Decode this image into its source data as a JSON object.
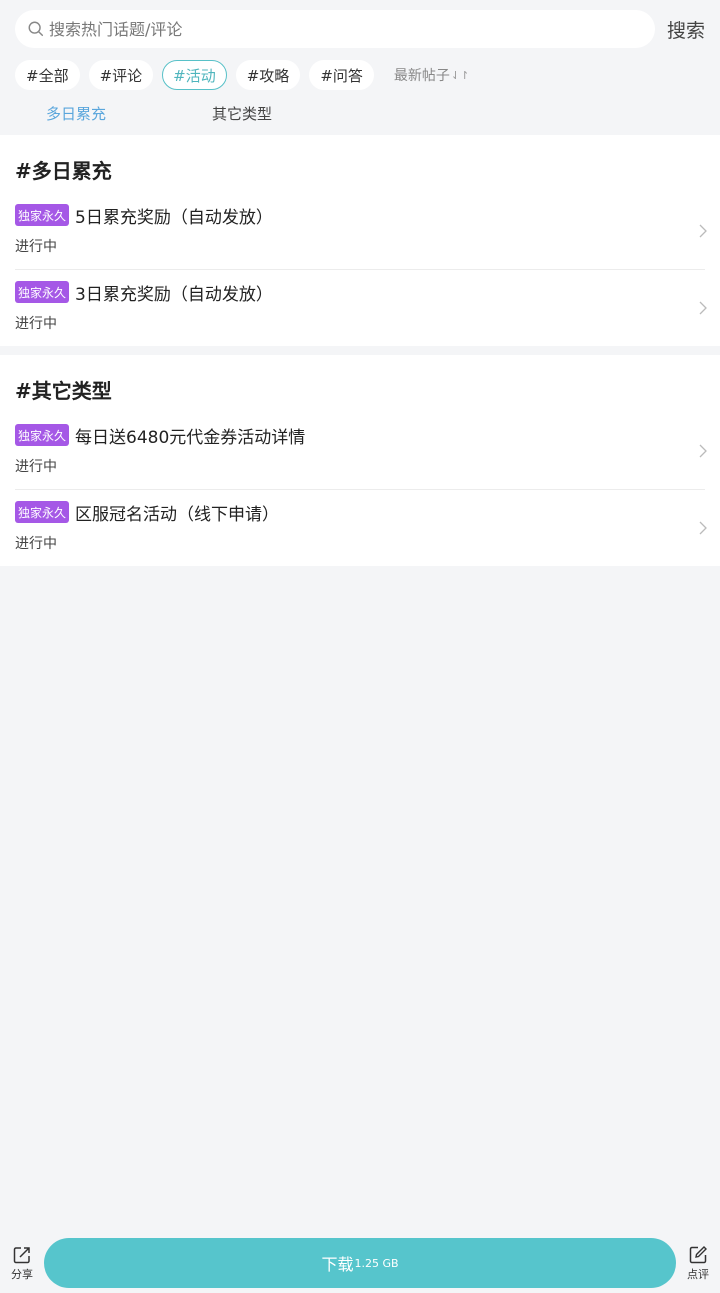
{
  "search": {
    "placeholder": "搜索热门话题/评论",
    "value": "",
    "button_label": "搜索"
  },
  "filters": {
    "chips": [
      "#全部",
      "#评论",
      "#活动",
      "#攻略",
      "#问答"
    ],
    "active_index": 2,
    "sort_label": "最新帖子",
    "sort_icon": "sort-arrows-icon"
  },
  "tabs": [
    {
      "label": "多日累充",
      "active": true
    },
    {
      "label": "其它类型",
      "active": false
    }
  ],
  "sections": [
    {
      "title": "#多日累充",
      "items": [
        {
          "badge": "独家永久",
          "title": "5日累充奖励（自动发放）",
          "status": "进行中"
        },
        {
          "badge": "独家永久",
          "title": "3日累充奖励（自动发放）",
          "status": "进行中"
        }
      ]
    },
    {
      "title": "#其它类型",
      "items": [
        {
          "badge": "独家永久",
          "title": "每日送6480元代金券活动详情",
          "status": "进行中"
        },
        {
          "badge": "独家永久",
          "title": "区服冠名活动（线下申请）",
          "status": "进行中"
        }
      ]
    }
  ],
  "bottom_bar": {
    "share_label": "分享",
    "download_label": "下载",
    "download_size": "1.25 GB",
    "review_label": "点评"
  },
  "colors": {
    "accent": "#56c5cc",
    "active_chip": "#4fb5bd",
    "active_tab": "#5aa6dc",
    "badge": "#a558e6",
    "background": "#f4f5f7"
  }
}
